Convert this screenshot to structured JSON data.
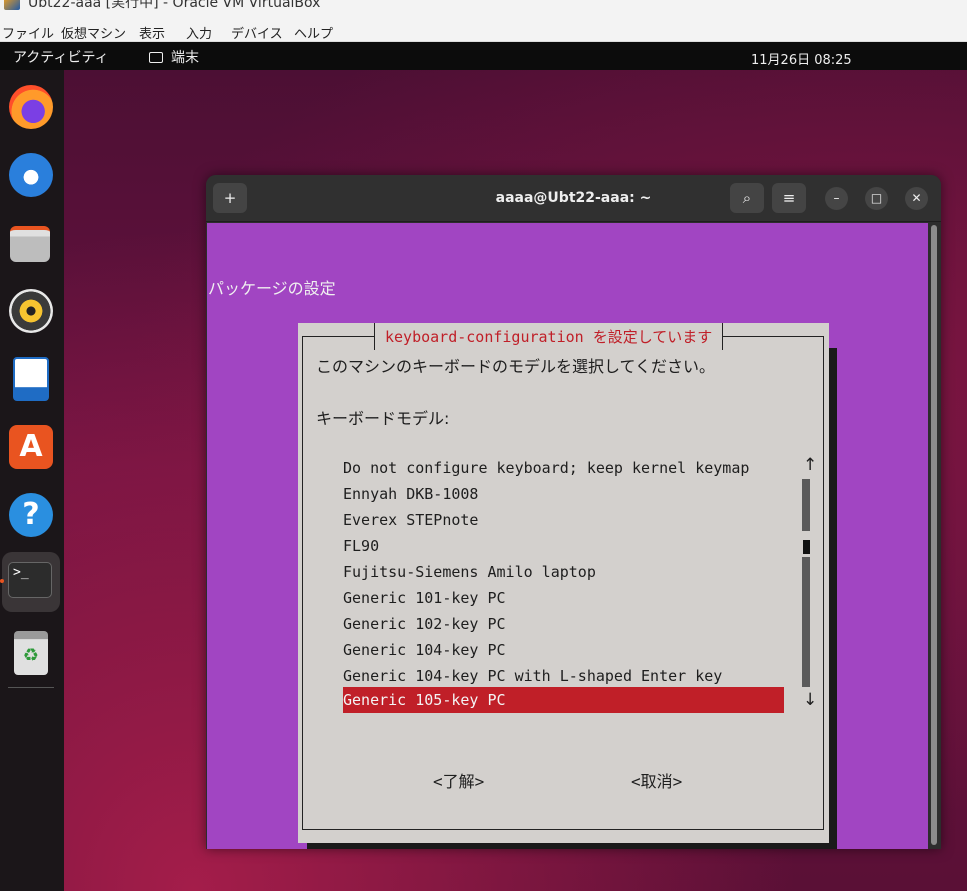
{
  "vbox": {
    "title": "Ubt22-aaa [実行中] - Oracle VM VirtualBox",
    "menu": [
      "ファイル",
      "仮想マシン",
      "表示",
      "入力",
      "デバイス",
      "ヘルプ"
    ]
  },
  "topbar": {
    "activities": "アクティビティ",
    "app_name": "端末",
    "clock": "11月26日  08:25"
  },
  "dock": {
    "items": [
      "firefox",
      "thunderbird",
      "files",
      "rhythmbox",
      "libreoffice-writer",
      "app-center",
      "help",
      "terminal",
      "trash"
    ]
  },
  "terminal": {
    "title": "aaaa@Ubt22-aaa: ~",
    "new_tab_icon": "+",
    "search_icon": "⌕",
    "menu_icon": "≡",
    "minimize_icon": "–",
    "maximize_icon": "□",
    "close_icon": "✕"
  },
  "whiptail": {
    "backtitle": "パッケージの設定",
    "title": "keyboard-configuration を設定しています",
    "prompt": "このマシンのキーボードのモデルを選択してください。",
    "label": "キーボードモデル:",
    "items": [
      "Do not configure keyboard; keep kernel keymap",
      "Ennyah DKB-1008",
      "Everex STEPnote",
      "FL90",
      "Fujitsu-Siemens Amilo laptop",
      "Generic 101-key PC",
      "Generic 102-key PC",
      "Generic 104-key PC",
      "Generic 104-key PC with L-shaped Enter key",
      "Generic 105-key PC"
    ],
    "selected_index": 9,
    "scroll_up": "↑",
    "scroll_down": "↓",
    "ok_label": "<了解>",
    "cancel_label": "<取消>"
  }
}
